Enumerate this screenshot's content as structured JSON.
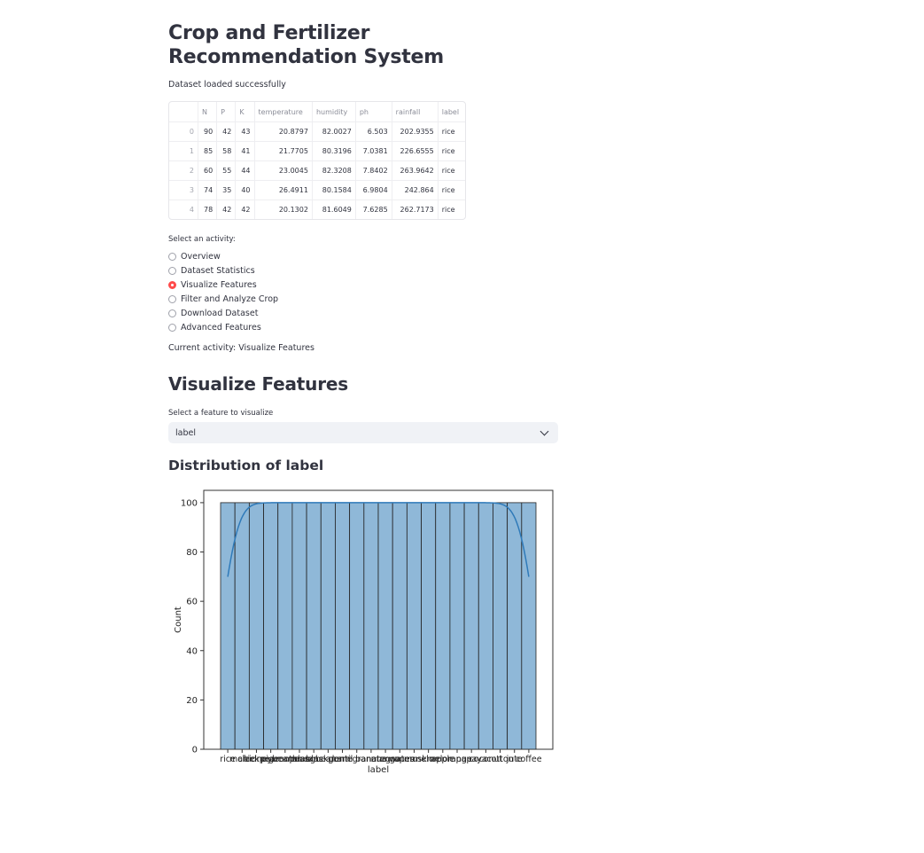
{
  "page": {
    "title": "Crop and Fertilizer Recommendation System",
    "status_message": "Dataset loaded successfully"
  },
  "dataframe": {
    "columns": [
      "",
      "N",
      "P",
      "K",
      "temperature",
      "humidity",
      "ph",
      "rainfall",
      "label"
    ],
    "rows": [
      [
        "0",
        "90",
        "42",
        "43",
        "20.8797",
        "82.0027",
        "6.503",
        "202.9355",
        "rice"
      ],
      [
        "1",
        "85",
        "58",
        "41",
        "21.7705",
        "80.3196",
        "7.0381",
        "226.6555",
        "rice"
      ],
      [
        "2",
        "60",
        "55",
        "44",
        "23.0045",
        "82.3208",
        "7.8402",
        "263.9642",
        "rice"
      ],
      [
        "3",
        "74",
        "35",
        "40",
        "26.4911",
        "80.1584",
        "6.9804",
        "242.864",
        "rice"
      ],
      [
        "4",
        "78",
        "42",
        "42",
        "20.1302",
        "81.6049",
        "7.6285",
        "262.7173",
        "rice"
      ]
    ]
  },
  "activity": {
    "label": "Select an activity:",
    "options": [
      "Overview",
      "Dataset Statistics",
      "Visualize Features",
      "Filter and Analyze Crop",
      "Download Dataset",
      "Advanced Features"
    ],
    "selected_index": 2,
    "current_text": "Current activity: Visualize Features"
  },
  "visualize": {
    "heading": "Visualize Features",
    "select_label": "Select a feature to visualize",
    "selected_feature": "label",
    "chart_heading": "Distribution of label"
  },
  "colors": {
    "accent": "#ff4b4b",
    "bar_fill": "#8fb8d8",
    "kde_line": "#2f7ab9"
  },
  "chart_data": {
    "type": "bar",
    "categories": [
      "rice",
      "maize",
      "chickpea",
      "kidneybeans",
      "pigeonpeas",
      "mothbeans",
      "mungbean",
      "blackgram",
      "lentil",
      "pomegranate",
      "banana",
      "mango",
      "grapes",
      "watermelon",
      "muskmelon",
      "apple",
      "orange",
      "papaya",
      "coconut",
      "cotton",
      "jute",
      "coffee"
    ],
    "values": [
      100,
      100,
      100,
      100,
      100,
      100,
      100,
      100,
      100,
      100,
      100,
      100,
      100,
      100,
      100,
      100,
      100,
      100,
      100,
      100,
      100,
      100
    ],
    "kde": true,
    "xlabel": "label",
    "ylabel": "Count",
    "ylim": [
      0,
      105
    ],
    "yticks": [
      0,
      20,
      40,
      60,
      80,
      100
    ],
    "grid": false
  }
}
